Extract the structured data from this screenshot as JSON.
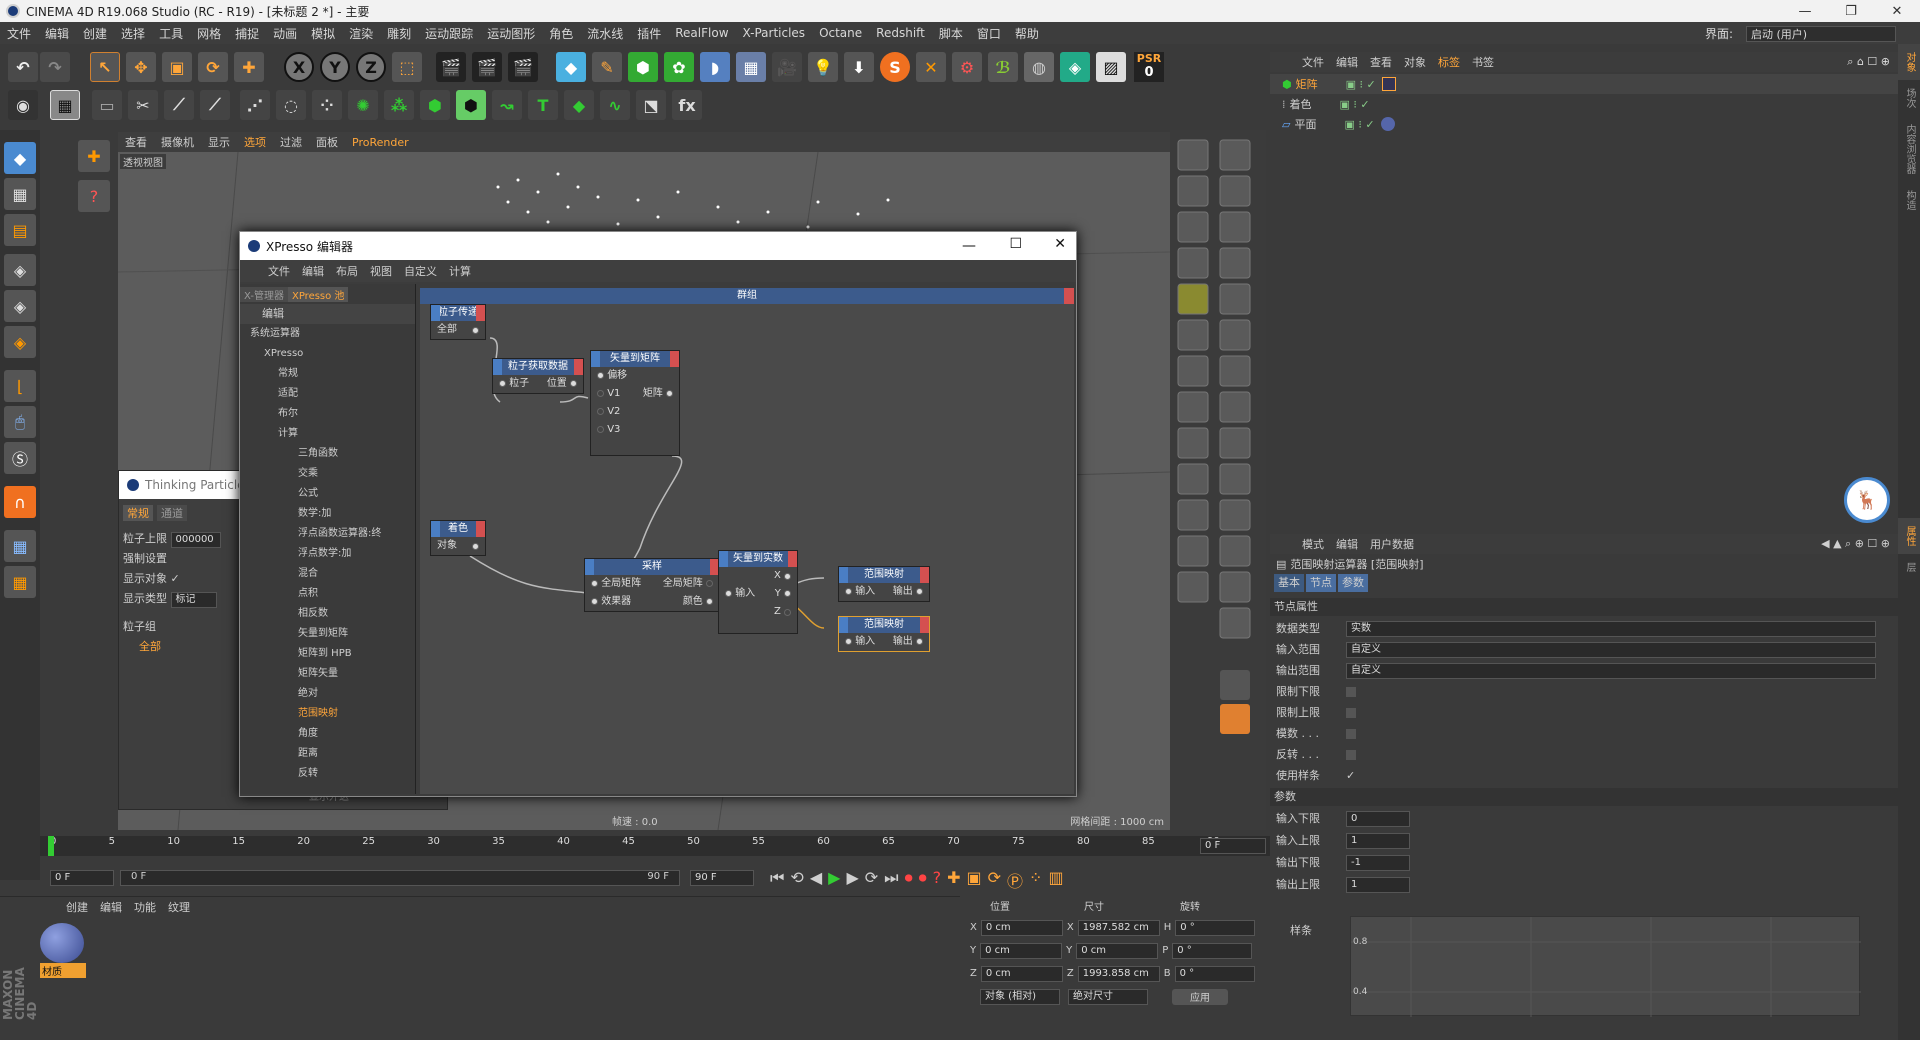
{
  "window": {
    "title": "CINEMA 4D R19.068 Studio (RC - R19) - [未标题 2 *] - 主要",
    "min": "—",
    "max": "❐",
    "close": "✕"
  },
  "menubar": {
    "items": [
      "文件",
      "编辑",
      "创建",
      "选择",
      "工具",
      "网格",
      "捕捉",
      "动画",
      "模拟",
      "渲染",
      "雕刻",
      "运动跟踪",
      "运动图形",
      "角色",
      "流水线",
      "插件",
      "RealFlow",
      "X-Particles",
      "Octane",
      "Redshift",
      "脚本",
      "窗口",
      "帮助"
    ],
    "interface_label": "界面:",
    "interface_value": "启动 (用户)"
  },
  "toolbar": {
    "psr_label": "PSR",
    "psr_value": "0"
  },
  "viewport": {
    "menu": [
      "查看",
      "摄像机",
      "显示",
      "选项",
      "过滤",
      "面板",
      "ProRender"
    ],
    "label": "透视视图",
    "speed": "帧速 : 0.0",
    "grid": "网格间距 : 1000 cm"
  },
  "thinking_particles": {
    "title": "Thinking Particle",
    "tabs": [
      "常规",
      "通道"
    ],
    "rows": [
      {
        "label": "粒子上限",
        "value": "000000"
      },
      {
        "label": "强制设置",
        "value": ""
      },
      {
        "label": "显示对象",
        "value": "✓"
      },
      {
        "label": "显示类型",
        "value": "标记"
      }
    ],
    "group_label": "粒子组",
    "group_item": "全部",
    "bottom_label": "显示外这"
  },
  "xpresso": {
    "title": "XPresso 编辑器",
    "menu": [
      "文件",
      "编辑",
      "布局",
      "视图",
      "自定义",
      "计算"
    ],
    "tabs": [
      "X-管理器",
      "XPresso 池"
    ],
    "pool_header": "编辑",
    "group_title": "群组",
    "tree": [
      "系统运算器",
      "XPresso",
      "常规",
      "适配",
      "布尔",
      "计算",
      "三角函数",
      "交乘",
      "公式",
      "数学:加",
      "浮点函数运算器:终",
      "浮点数学:加",
      "混合",
      "点积",
      "相反数",
      "矢量到矩阵",
      "矩阵到 HPB",
      "矩阵矢量",
      "绝对",
      "范围映射",
      "角度",
      "距离",
      "反转"
    ],
    "nodes": {
      "pt": {
        "title": "粒子传递",
        "ports": [
          "全部"
        ]
      },
      "pget": {
        "title": "粒子获取数据",
        "in": "粒子",
        "out": "位置"
      },
      "v2m": {
        "title": "矢量到矩阵",
        "in": [
          "偏移",
          "V1",
          "V2",
          "V3"
        ],
        "out": "矩阵"
      },
      "col": {
        "title": "着色",
        "out": "对象"
      },
      "sample": {
        "title": "采样",
        "in": [
          "全局矩阵",
          "效果器"
        ],
        "out": [
          "全局矩阵",
          "颜色"
        ]
      },
      "v2r": {
        "title": "矢量到实数",
        "in": "输入",
        "out": [
          "X",
          "Y",
          "Z"
        ]
      },
      "rm1": {
        "title": "范围映射",
        "in": "输入",
        "out": "输出"
      },
      "rm2": {
        "title": "范围映射",
        "in": "输入",
        "out": "输出"
      }
    }
  },
  "timeline": {
    "ticks": [
      "0",
      "5",
      "10",
      "15",
      "20",
      "25",
      "30",
      "35",
      "40",
      "45",
      "50",
      "55",
      "60",
      "65",
      "70",
      "75",
      "80",
      "85",
      "90"
    ],
    "current": "0 F",
    "start": "0 F",
    "range_start": "0 F",
    "range_end": "90 F",
    "end": "90 F"
  },
  "material": {
    "menu": [
      "创建",
      "编辑",
      "功能",
      "纹理"
    ],
    "name": "材质",
    "brand1": "MAXON",
    "brand2": "CINEMA 4D"
  },
  "coords": {
    "headers": [
      "位置",
      "尺寸",
      "旋转"
    ],
    "rows": [
      {
        "axis": "X",
        "pos": "0 cm",
        "size_axis": "X",
        "size": "1987.582 cm",
        "rot_axis": "H",
        "rot": "0 °"
      },
      {
        "axis": "Y",
        "pos": "0 cm",
        "size_axis": "Y",
        "size": "0 cm",
        "rot_axis": "P",
        "rot": "0 °"
      },
      {
        "axis": "Z",
        "pos": "0 cm",
        "size_axis": "Z",
        "size": "1993.858 cm",
        "rot_axis": "B",
        "rot": "0 °"
      }
    ],
    "mode1": "对象 (相对)",
    "mode2": "绝对尺寸",
    "apply": "应用"
  },
  "object_manager": {
    "menu": [
      "文件",
      "编辑",
      "查看",
      "对象",
      "标签",
      "书签"
    ],
    "objects": [
      {
        "name": "矩阵",
        "active": true
      },
      {
        "name": "着色",
        "active": false
      },
      {
        "name": "平面",
        "active": false
      }
    ]
  },
  "attributes": {
    "menu": [
      "模式",
      "编辑",
      "用户数据"
    ],
    "title": "范围映射运算器 [范围映射]",
    "tabs": [
      "基本",
      "节点",
      "参数"
    ],
    "section1": "节点属性",
    "rows1": [
      {
        "label": "数据类型",
        "value": "实数"
      },
      {
        "label": "输入范围",
        "value": "自定义"
      },
      {
        "label": "输出范围",
        "value": "自定义"
      }
    ],
    "checks": [
      {
        "label": "限制下限",
        "checked": ""
      },
      {
        "label": "限制上限",
        "checked": ""
      },
      {
        "label": "模数 . . .",
        "checked": ""
      },
      {
        "label": "反转 . . .",
        "checked": ""
      },
      {
        "label": "使用样条",
        "checked": "✓"
      }
    ],
    "section2": "参数",
    "params": [
      {
        "label": "输入下限",
        "value": "0"
      },
      {
        "label": "输入上限",
        "value": "1"
      },
      {
        "label": "输出下限",
        "value": "-1"
      },
      {
        "label": "输出上限",
        "value": "1"
      }
    ],
    "spline_label": "样条",
    "spline_ticks": [
      "0.8",
      "0.4"
    ]
  },
  "sidetabs": [
    "对象",
    "场次",
    "内容浏览器",
    "构造",
    "属性",
    "层"
  ]
}
